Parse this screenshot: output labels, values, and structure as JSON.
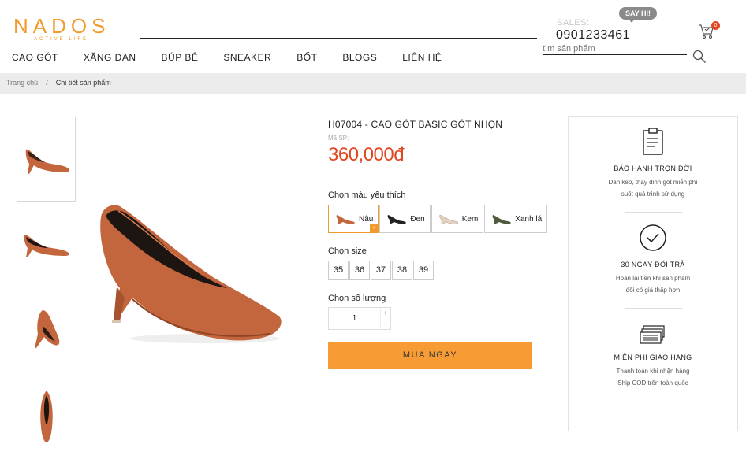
{
  "brand": {
    "name": "NADOS",
    "tagline": "ACTIVE LIFE"
  },
  "nav": [
    "CAO GÓT",
    "XĂNG ĐAN",
    "BÚP BÊ",
    "SNEAKER",
    "BỐT",
    "BLOGS",
    "LIÊN HỆ"
  ],
  "sales": {
    "label": "SALES:",
    "phone": "0901233461",
    "bubble": "SAY HI!"
  },
  "cart": {
    "count": "0"
  },
  "search": {
    "placeholder": "tìm sản phẩm"
  },
  "breadcrumb": {
    "home": "Trang chủ",
    "sep": "/",
    "current": "Chi tiết sản phẩm"
  },
  "product": {
    "title": "H07004 - CAO GÓT BASIC GÓT NHỌN",
    "sku_label": "Mã SP:",
    "price": "360,000đ",
    "color_label": "Chọn màu yêu thích",
    "colors": [
      {
        "name": "Nâu",
        "hex": "#c4663d",
        "selected": true
      },
      {
        "name": "Đen",
        "hex": "#222222",
        "selected": false
      },
      {
        "name": "Kem",
        "hex": "#e4d2c0",
        "selected": false
      },
      {
        "name": "Xanh lá",
        "hex": "#4d5a3c",
        "selected": false
      }
    ],
    "size_label": "Chọn size",
    "sizes": [
      "35",
      "36",
      "37",
      "38",
      "39"
    ],
    "qty_label": "Chọn số lượng",
    "qty": "1",
    "qty_plus": "+",
    "qty_minus": "-",
    "buy_label": "MUA NGAY",
    "shoe_color": "#c4663d"
  },
  "policy": [
    {
      "icon": "clipboard-icon",
      "title": "BẢO HÀNH TRỌN ĐỜI",
      "lines": [
        "Dán keo, thay đinh gót miễn phí",
        "suốt quá trình sử dụng"
      ]
    },
    {
      "icon": "check-circle-icon",
      "title": "30 NGÀY ĐỔI TRẢ",
      "lines": [
        "Hoàn lại tiền khi sản phẩm",
        "đổi có giá thấp hơn"
      ]
    },
    {
      "icon": "money-icon",
      "title": "MIỄN PHÍ GIAO HÀNG",
      "lines": [
        "Thanh toán khi nhận hàng",
        "Ship COD trên toàn quốc"
      ]
    }
  ]
}
